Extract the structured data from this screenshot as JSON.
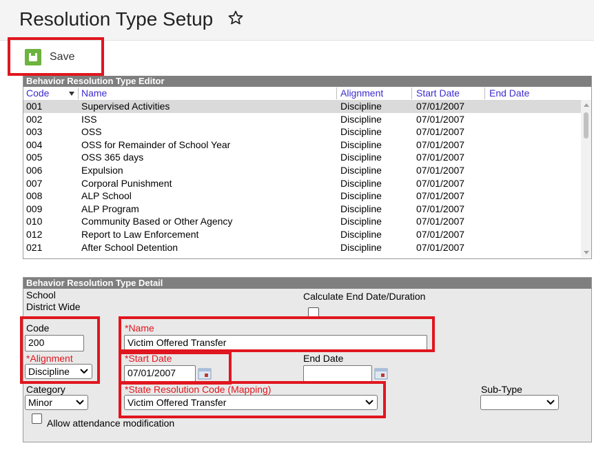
{
  "page": {
    "title": "Resolution Type Setup"
  },
  "toolbar": {
    "save_label": "Save"
  },
  "editor": {
    "header": "Behavior Resolution Type Editor",
    "columns": [
      "Code",
      "Name",
      "Alignment",
      "Start Date",
      "End Date"
    ],
    "rows": [
      {
        "code": "001",
        "name": "Supervised Activities",
        "alignment": "Discipline",
        "start": "07/01/2007",
        "end": ""
      },
      {
        "code": "002",
        "name": "ISS",
        "alignment": "Discipline",
        "start": "07/01/2007",
        "end": ""
      },
      {
        "code": "003",
        "name": "OSS",
        "alignment": "Discipline",
        "start": "07/01/2007",
        "end": ""
      },
      {
        "code": "004",
        "name": "OSS for Remainder of School Year",
        "alignment": "Discipline",
        "start": "07/01/2007",
        "end": ""
      },
      {
        "code": "005",
        "name": "OSS 365 days",
        "alignment": "Discipline",
        "start": "07/01/2007",
        "end": ""
      },
      {
        "code": "006",
        "name": "Expulsion",
        "alignment": "Discipline",
        "start": "07/01/2007",
        "end": ""
      },
      {
        "code": "007",
        "name": "Corporal Punishment",
        "alignment": "Discipline",
        "start": "07/01/2007",
        "end": ""
      },
      {
        "code": "008",
        "name": "ALP School",
        "alignment": "Discipline",
        "start": "07/01/2007",
        "end": ""
      },
      {
        "code": "009",
        "name": "ALP Program",
        "alignment": "Discipline",
        "start": "07/01/2007",
        "end": ""
      },
      {
        "code": "010",
        "name": "Community Based or Other Agency",
        "alignment": "Discipline",
        "start": "07/01/2007",
        "end": ""
      },
      {
        "code": "012",
        "name": "Report to Law Enforcement",
        "alignment": "Discipline",
        "start": "07/01/2007",
        "end": ""
      },
      {
        "code": "021",
        "name": "After School Detention",
        "alignment": "Discipline",
        "start": "07/01/2007",
        "end": ""
      }
    ]
  },
  "detail": {
    "header": "Behavior Resolution Type Detail",
    "school_label": "School",
    "school_value": "District Wide",
    "calc_label": "Calculate End Date/Duration",
    "code_label": "Code",
    "code_value": "200",
    "name_label": "*Name",
    "name_value": "Victim Offered Transfer",
    "alignment_label": "*Alignment",
    "alignment_value": "Discipline",
    "start_label": "*Start Date",
    "start_value": "07/01/2007",
    "end_label": "End Date",
    "end_value": "",
    "category_label": "Category",
    "category_value": "Minor",
    "state_code_label": "*State Resolution Code (Mapping)",
    "state_code_value": "Victim Offered Transfer",
    "subtype_label": "Sub-Type",
    "subtype_value": "",
    "attendance_label": "Allow attendance modification"
  },
  "colors": {
    "highlight": "#e0161e",
    "save_green": "#6cb33f",
    "link_blue": "#3b2ccf",
    "required_red": "#e0161e"
  }
}
